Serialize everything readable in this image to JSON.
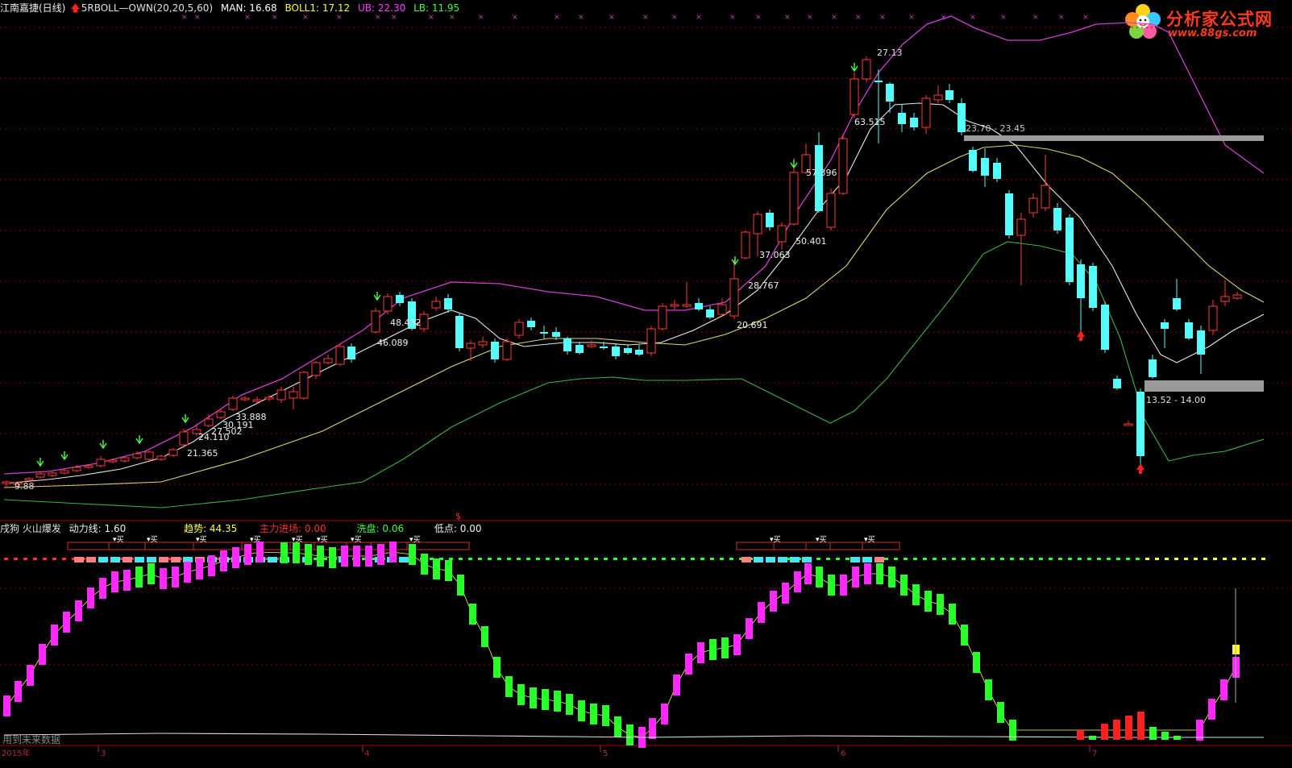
{
  "header": {
    "stock_name": "江南嘉捷(日线)",
    "indicator_name": "5RBOLL—OWN(20,20,5,60)",
    "man": "MAN: 16.68",
    "boll": "BOLL1: 17.12",
    "ub": "UB: 22.30",
    "lb": "LB: 11.95"
  },
  "sub_header": {
    "name": "戌狗 火山爆发",
    "power": "动力线: 1.60",
    "trend": "趋势: 44.35",
    "main_force": "主力进场: 0.00",
    "wash": "洗盘: 0.06",
    "low": "低点: 0.00"
  },
  "logo": {
    "title": "分析家公式网",
    "url": "www.88gs.com"
  },
  "price_labels": {
    "low_price": "9.88",
    "top_price": "27.13",
    "resistance_zone": "23.70 - 23.45",
    "support_zone": "13.52 - 14.00",
    "marker_s": "$"
  },
  "buy_labels": [
    "21.365",
    "24.110",
    "27.502",
    "30.191",
    "33.888",
    "46.089",
    "48.432",
    "20.691",
    "28.767",
    "37.063",
    "50.401",
    "57.396",
    "63.515"
  ],
  "signal_text": [
    "买",
    "买",
    "买",
    "买",
    "买",
    "买",
    "买",
    "买",
    "买",
    "买"
  ],
  "bottom_watermark": "用到未来数据",
  "time_axis": [
    "2015年",
    "3",
    "4",
    "5",
    "6",
    "7"
  ],
  "colors": {
    "up_candle": "#ff3c3c",
    "down_candle": "#54fcfc",
    "upper_band": "#d040d0",
    "mid_band": "#d8d870",
    "lower_band": "#3cb43c",
    "ma_line": "#e8e8e8",
    "osc_up": "#ff28ff",
    "osc_down": "#28ff28"
  }
}
